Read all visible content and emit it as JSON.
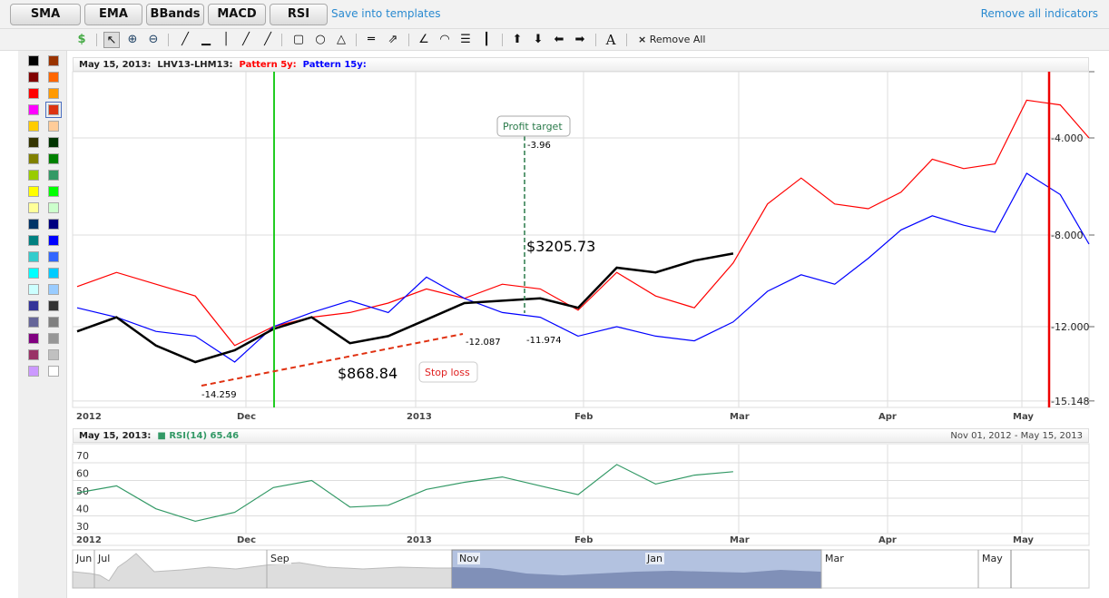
{
  "indicator_buttons": [
    "SMA",
    "EMA",
    "BBands",
    "MACD",
    "RSI"
  ],
  "save_templates": "Save into templates",
  "remove_all_indicators": "Remove all indicators",
  "toolbar": {
    "remove_all": "Remove All",
    "remove_icon": "×",
    "text_tool": "A",
    "dollar": "$"
  },
  "palette": [
    "#000000",
    "#993300",
    "#800000",
    "#ff6600",
    "#ff0000",
    "#ff9900",
    "#ff00ff",
    "#dd3311",
    "#ffcc00",
    "#ffcc99",
    "#333300",
    "#003300",
    "#808000",
    "#008000",
    "#99cc00",
    "#339966",
    "#ffff00",
    "#00ff00",
    "#ffff99",
    "#ccffcc",
    "#003366",
    "#000080",
    "#008080",
    "#0000ff",
    "#33cccc",
    "#3366ff",
    "#00ffff",
    "#00ccff",
    "#ccffff",
    "#99ccff",
    "#333399",
    "#333333",
    "#666699",
    "#808080",
    "#800080",
    "#969696",
    "#993366",
    "#c0c0c0",
    "#cc99ff",
    "#ffffff"
  ],
  "main": {
    "header": {
      "date": "May 15, 2013:",
      "symbol": "LHV13-LHM13:",
      "s1": "Pattern 5y:",
      "s2": "Pattern 15y:"
    },
    "y_ticks": [
      "-4.000",
      "-8.000",
      "-12.000",
      "-15.148"
    ],
    "x_ticks": [
      "2012",
      "Dec",
      "2013",
      "Feb",
      "Mar",
      "Apr",
      "May"
    ],
    "annotations": {
      "low": "-14.259",
      "trend_end": "-12.087",
      "entry": "-11.974",
      "target_val": "-3.96",
      "profit_amt": "$3205.73",
      "loss_amt": "$868.84",
      "stop_loss": "Stop loss",
      "profit_target": "Profit target"
    }
  },
  "rsi": {
    "date": "May 15, 2013:",
    "label": "RSI(14) 65.46",
    "range": "Nov 01, 2012 - May 15, 2013",
    "y_ticks": [
      "70",
      "60",
      "50",
      "40",
      "30"
    ],
    "color": "#339966"
  },
  "navigator": {
    "labels": [
      "Jun",
      "Jul",
      "Sep",
      "Nov",
      "Jan",
      "Mar",
      "May"
    ]
  },
  "chart_data": {
    "type": "line",
    "dates": [
      "2012-11-01",
      "2012-11-08",
      "2012-11-15",
      "2012-11-22",
      "2012-11-29",
      "2012-12-06",
      "2012-12-13",
      "2012-12-20",
      "2012-12-27",
      "2013-01-03",
      "2013-01-10",
      "2013-01-17",
      "2013-01-24",
      "2013-01-31",
      "2013-02-07",
      "2013-02-14",
      "2013-02-21",
      "2013-02-28",
      "2013-03-07",
      "2013-03-14",
      "2013-03-21",
      "2013-03-28",
      "2013-04-04",
      "2013-04-11",
      "2013-04-18",
      "2013-04-25",
      "2013-05-02",
      "2013-05-09",
      "2013-05-15"
    ],
    "series": [
      {
        "name": "Pattern 5y",
        "color": "#ff0000",
        "values": [
          -10.3,
          -9.7,
          -10.2,
          -10.7,
          -12.8,
          -12.0,
          -11.6,
          -11.4,
          -11.0,
          -10.4,
          -10.8,
          -10.2,
          -10.4,
          -11.3,
          -9.7,
          -10.7,
          -11.2,
          -9.3,
          -6.8,
          -5.7,
          -6.8,
          -7.0,
          -6.3,
          -4.9,
          -5.3,
          -5.1,
          -2.4,
          -2.6,
          -4.0
        ]
      },
      {
        "name": "Pattern 15y",
        "color": "#0000ff",
        "values": [
          -11.2,
          -11.6,
          -12.2,
          -12.4,
          -13.5,
          -12.0,
          -11.4,
          -10.9,
          -11.4,
          -9.9,
          -10.8,
          -11.4,
          -11.6,
          -12.4,
          -12.0,
          -12.4,
          -12.6,
          -11.8,
          -10.5,
          -9.8,
          -10.2,
          -9.1,
          -7.9,
          -7.3,
          -7.7,
          -8.0,
          -5.5,
          -6.4,
          -8.5
        ]
      },
      {
        "name": "LHV13-LHM13",
        "color": "#000000",
        "values": [
          -12.2,
          -11.6,
          -12.8,
          -13.5,
          -13.0,
          -12.1,
          -11.6,
          -12.7,
          -12.4,
          -11.7,
          -11.0,
          -10.9,
          -10.8,
          -11.2,
          -9.5,
          -9.7,
          -9.2,
          -8.9
        ]
      }
    ],
    "rsi_values": [
      53,
      57,
      44,
      37,
      42,
      56,
      60,
      45,
      46,
      55,
      59,
      62,
      57,
      52,
      69,
      58,
      63,
      65
    ],
    "ylim": [
      -15.148,
      -1.5
    ],
    "rsi_ylim": [
      27,
      75
    ],
    "grid": true
  }
}
